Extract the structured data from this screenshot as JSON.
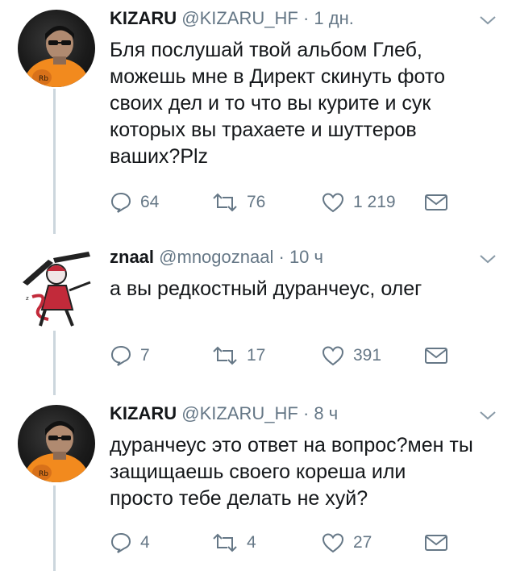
{
  "tweets": [
    {
      "name": "KIZARU",
      "handle": "@KIZARU_HF",
      "separator": "·",
      "time": "1 дн.",
      "avatar": "kizaru-avatar",
      "lines": [
        "Бля послушай твой альбом Глеб,",
        "можешь мне в Директ скинуть фото",
        "своих дел и то что вы курите и сук",
        "которых вы трахаете и шуттеров",
        "ваших?Plz"
      ],
      "replies": "64",
      "retweets": "76",
      "likes": "1 219"
    },
    {
      "name": "znaal",
      "handle": "@mnogoznaal",
      "separator": "·",
      "time": "10 ч",
      "avatar": "znaal-avatar",
      "lines": [
        "а вы редкостный дуранчеус, олег"
      ],
      "replies": "7",
      "retweets": "17",
      "likes": "391"
    },
    {
      "name": "KIZARU",
      "handle": "@KIZARU_HF",
      "separator": "·",
      "time": "8 ч",
      "avatar": "kizaru-avatar",
      "lines": [
        "дуранчеус это ответ на вопрос?мен ты",
        "защищаешь своего кореша или",
        "просто тебе делать не хуй?"
      ],
      "replies": "4",
      "retweets": "4",
      "likes": "27"
    }
  ],
  "icons": {
    "reply": "reply-icon",
    "retweet": "retweet-icon",
    "like": "heart-icon",
    "dm": "envelope-icon",
    "more": "chevron-down-icon"
  },
  "colors": {
    "text": "#14171a",
    "secondary": "#657786",
    "thread_line": "#ccd6dd",
    "avatar_accent": "#f28a1e"
  }
}
